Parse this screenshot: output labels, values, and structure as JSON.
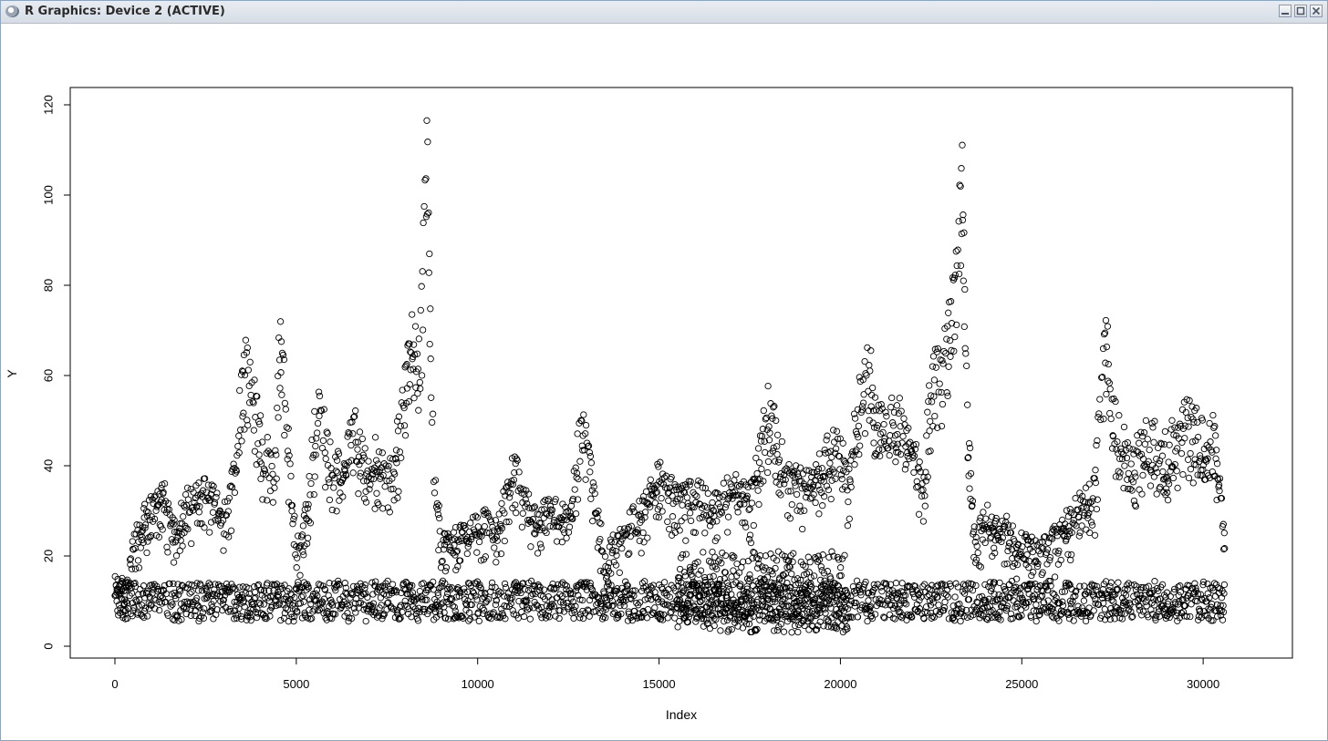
{
  "window": {
    "title": "R Graphics: Device 2 (ACTIVE)"
  },
  "icons": [
    "r-logo-icon",
    "minimize-icon",
    "maximize-icon",
    "close-icon"
  ],
  "chart_data": {
    "type": "scatter",
    "marker": "open-circle",
    "xlabel": "Index",
    "ylabel": "Y",
    "xlim": [
      0,
      30600
    ],
    "ylim": [
      0,
      120
    ],
    "x_ticks": [
      0,
      5000,
      10000,
      15000,
      20000,
      25000,
      30000
    ],
    "y_ticks": [
      0,
      20,
      40,
      60,
      80,
      100,
      120
    ],
    "n_points_approx": 30600,
    "series": [
      {
        "name": "",
        "upper_band_profile": {
          "x": [
            0,
            300,
            500,
            800,
            1000,
            1300,
            1600,
            2000,
            2500,
            3000,
            3300,
            3600,
            3800,
            4100,
            4400,
            4550,
            4800,
            5000,
            5300,
            5600,
            5700,
            6000,
            6300,
            6600,
            6900,
            7200,
            7500,
            7800,
            8000,
            8200,
            8400,
            8600,
            8700,
            8800,
            9000,
            9500,
            10000,
            10500,
            11000,
            11500,
            12000,
            12500,
            12900,
            13100,
            13500,
            14000,
            14500,
            15000,
            15500,
            16000,
            16500,
            17000,
            17500,
            18000,
            18500,
            19000,
            19500,
            20000,
            20200,
            20500,
            20800,
            21000,
            21500,
            22000,
            22300,
            22500,
            22800,
            23000,
            23200,
            23350,
            23500,
            23700,
            24000,
            24500,
            25000,
            25500,
            26000,
            26500,
            27000,
            27200,
            27300,
            27500,
            27800,
            28000,
            28500,
            29000,
            29500,
            30000,
            30300,
            30550
          ],
          "y": [
            12,
            13,
            22,
            28,
            30,
            35,
            25,
            32,
            35,
            28,
            40,
            66,
            55,
            42,
            38,
            72,
            40,
            20,
            30,
            56,
            50,
            38,
            42,
            48,
            40,
            42,
            38,
            45,
            60,
            70,
            62,
            118,
            64,
            38,
            22,
            24,
            28,
            25,
            40,
            28,
            30,
            28,
            50,
            40,
            18,
            25,
            30,
            38,
            32,
            34,
            30,
            36,
            32,
            52,
            38,
            36,
            40,
            44,
            34,
            55,
            62,
            48,
            50,
            46,
            34,
            60,
            62,
            72,
            88,
            106,
            50,
            22,
            28,
            26,
            22,
            20,
            24,
            30,
            34,
            60,
            72,
            50,
            44,
            40,
            45,
            42,
            50,
            45,
            48,
            28
          ]
        },
        "lower_band": {
          "center": 10,
          "spread": [
            5,
            15
          ]
        },
        "mid_noise_cluster": {
          "x_range": [
            15500,
            20200
          ],
          "y_range": [
            3,
            21
          ]
        }
      }
    ]
  }
}
